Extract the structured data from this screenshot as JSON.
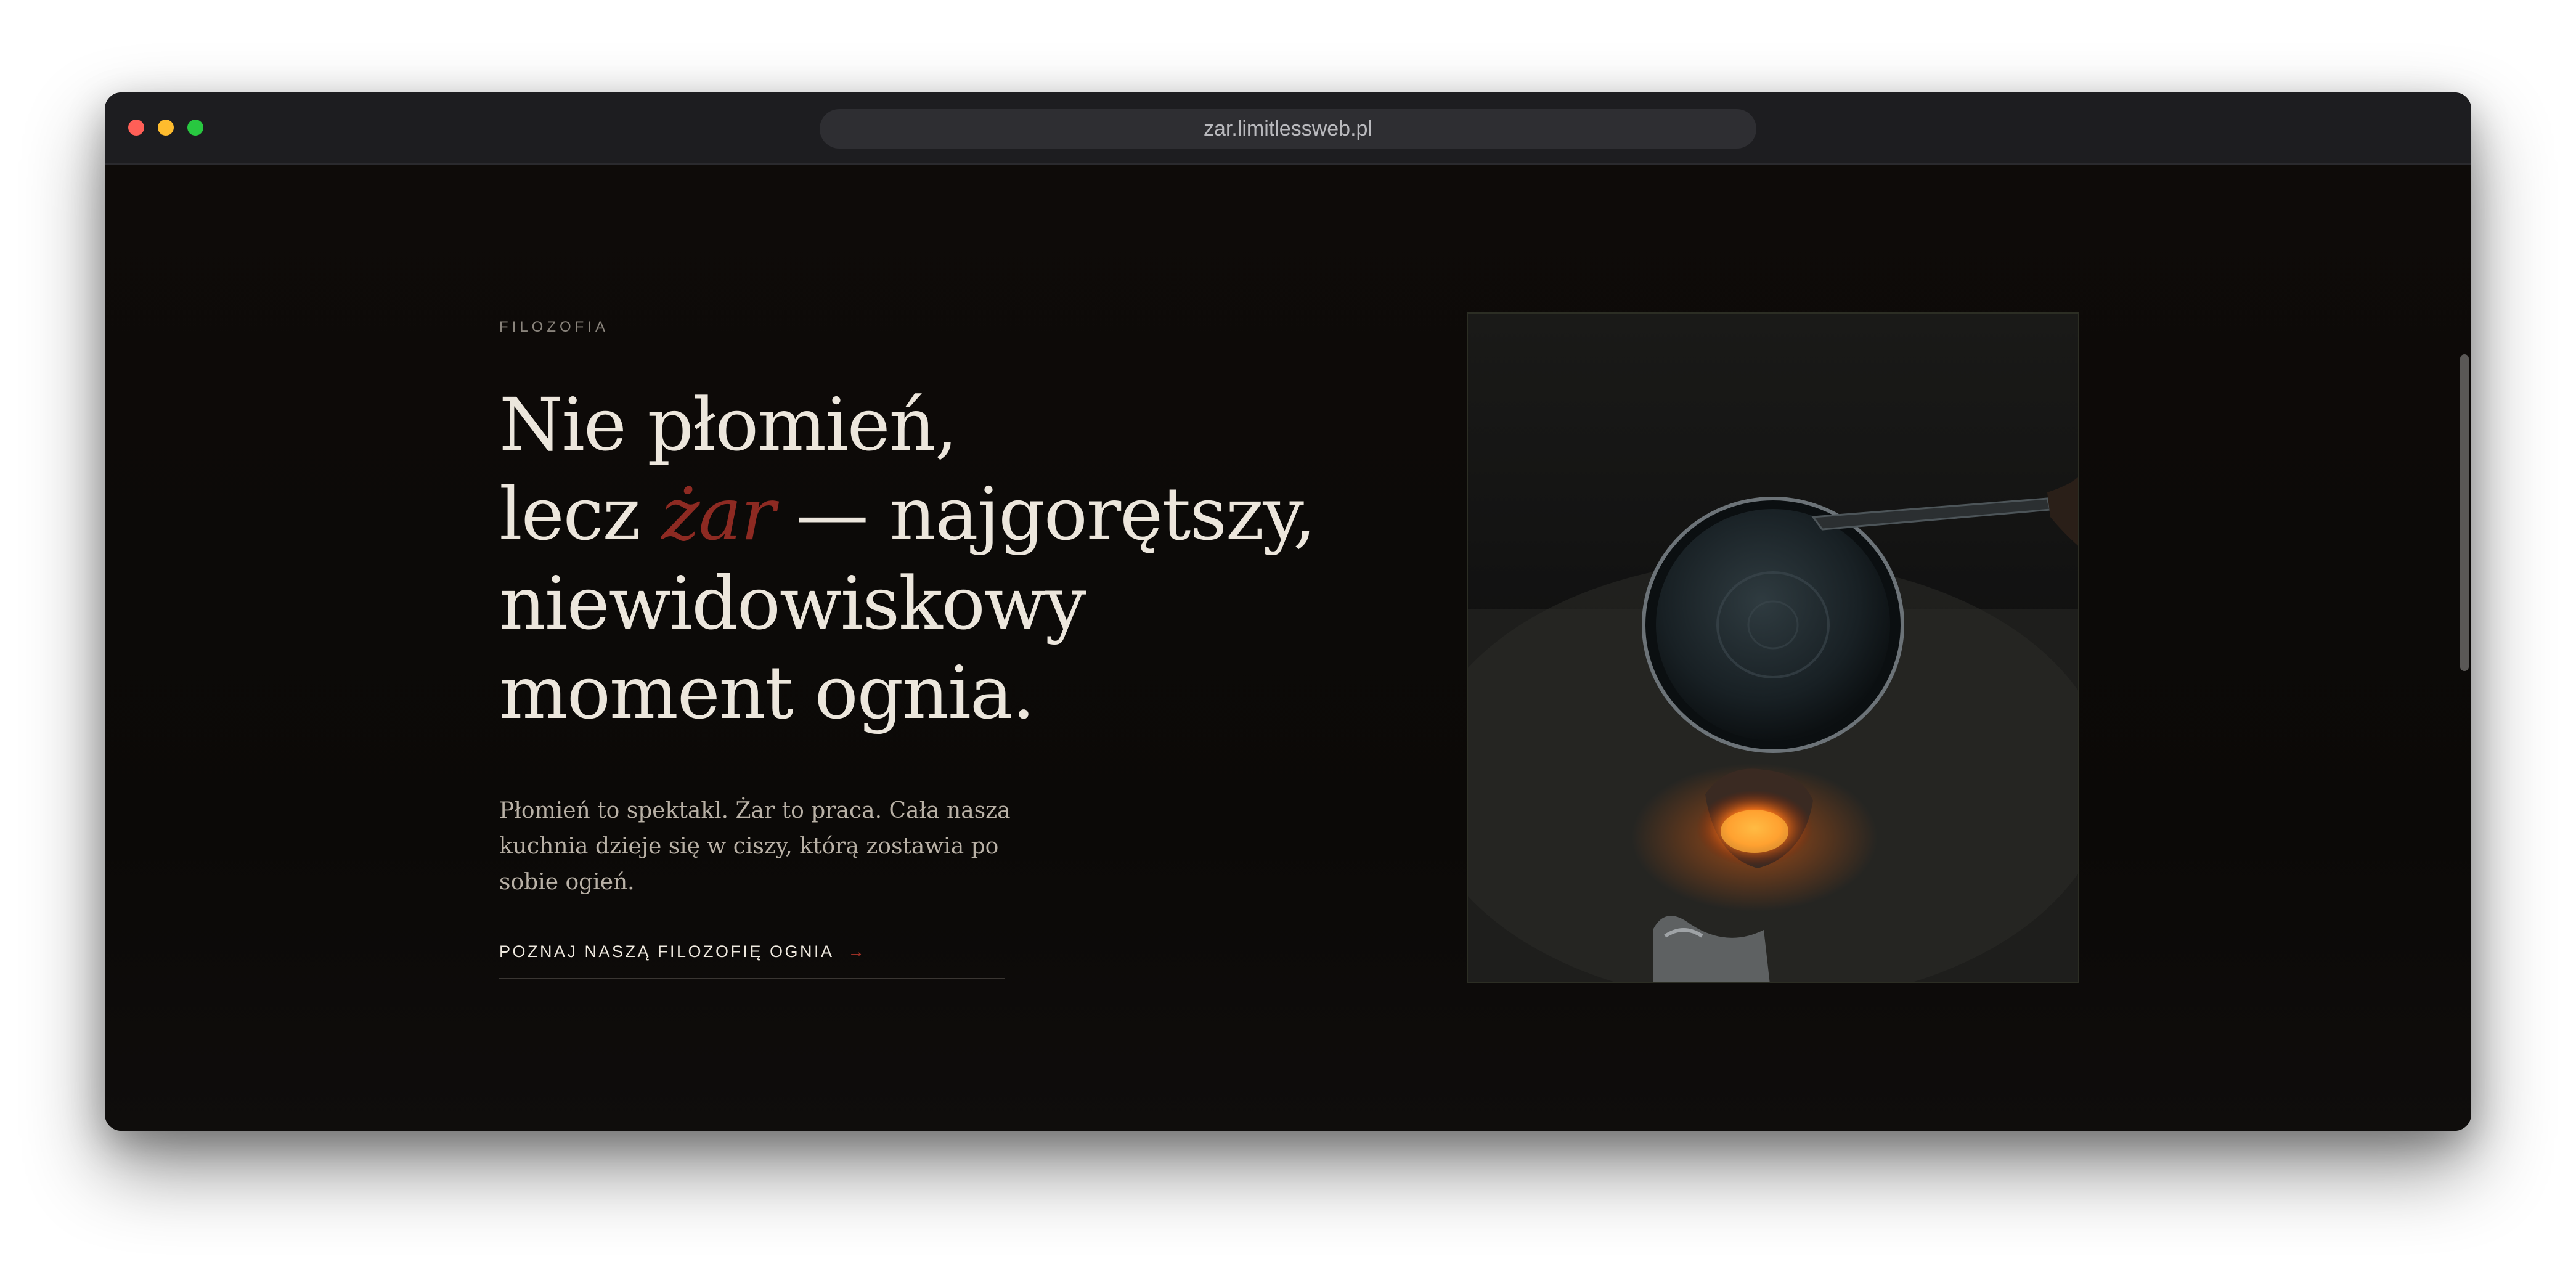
{
  "browser": {
    "url": "zar.limitlessweb.pl"
  },
  "hero": {
    "eyebrow": "FILOZOFIA",
    "headline": {
      "line1": "Nie płomień,",
      "line2_before": "lecz ",
      "line2_accent": "żar",
      "line2_after": " — najgorętszy,",
      "line3": "niewidowiskowy",
      "line4": "moment ognia."
    },
    "body": "Płomień to spektakl. Żar to praca. Cała nasza kuchnia dzieje się w ciszy, którą zostawia po sobie ogień.",
    "cta_label": "POZNAJ NASZĄ FILOZOFIĘ OGNIA",
    "cta_arrow": "→"
  },
  "colors": {
    "background": "#0d0a08",
    "headline": "#ece6dc",
    "accent": "#8d2a22",
    "body": "#b9b1a6",
    "eyebrow": "#8a847c"
  }
}
